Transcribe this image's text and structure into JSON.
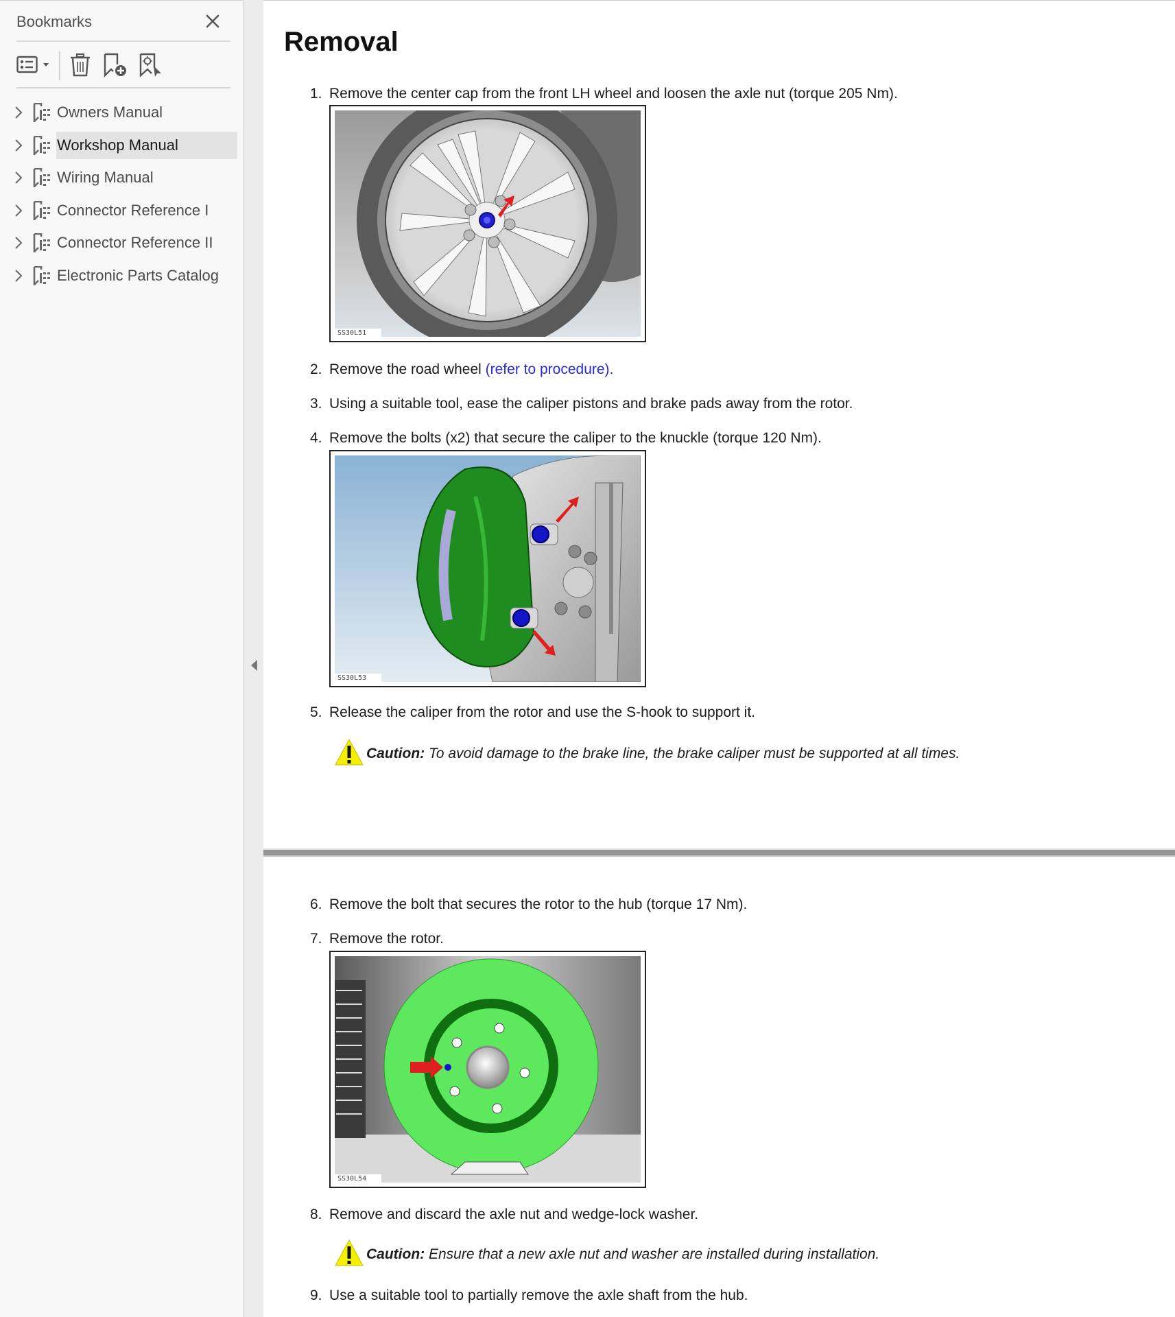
{
  "sidebar": {
    "title": "Bookmarks",
    "toolbar": {
      "options_icon": "list-options-icon",
      "delete_icon": "trash-icon",
      "add_icon": "add-bookmark-icon",
      "find_icon": "find-bookmark-icon"
    },
    "items": [
      {
        "label": "Owners Manual",
        "selected": false
      },
      {
        "label": "Workshop Manual",
        "selected": true
      },
      {
        "label": "Wiring Manual",
        "selected": false
      },
      {
        "label": "Connector Reference I",
        "selected": false
      },
      {
        "label": "Connector Reference II",
        "selected": false
      },
      {
        "label": "Electronic Parts Catalog",
        "selected": false
      }
    ]
  },
  "document": {
    "title": "Removal",
    "steps": [
      {
        "num": "1.",
        "text": "Remove the center cap from the front LH wheel and loosen the axle nut (torque 205 Nm)."
      },
      {
        "num": "2.",
        "text": "Remove the road wheel ",
        "link": "(refer to procedure)",
        "after": "."
      },
      {
        "num": "3.",
        "text": "Using a suitable tool, ease the caliper pistons and brake pads away from the rotor."
      },
      {
        "num": "4.",
        "text": "Remove the bolts (x2) that secure the caliper to the knuckle (torque 120 Nm)."
      },
      {
        "num": "5.",
        "text": "Release the caliper from the rotor and use the S-hook to support it."
      },
      {
        "num": "6.",
        "text": "Remove the bolt that secures the rotor to the hub (torque 17 Nm)."
      },
      {
        "num": "7.",
        "text": "Remove the rotor."
      },
      {
        "num": "8.",
        "text": "Remove and discard the axle nut and wedge-lock washer."
      },
      {
        "num": "9.",
        "text": "Use a suitable tool to partially remove the axle shaft from the hub."
      }
    ],
    "figures": [
      {
        "id": "SS30L51",
        "alt": "Front LH wheel with arrow at center cap / axle nut"
      },
      {
        "id": "SS30L53",
        "alt": "Green brake caliper with two blue mounting bolts indicated by arrows"
      },
      {
        "id": "SS30L54",
        "alt": "Green brake rotor with arrow at rotor retaining bolt"
      }
    ],
    "cautions": [
      {
        "label": "Caution:",
        "text": " To avoid damage to the brake line, the brake caliper must be supported at all times."
      },
      {
        "label": "Caution:",
        "text": " Ensure that a new axle nut and washer are installed during installation."
      }
    ]
  },
  "colors": {
    "link": "#2a2ad0",
    "highlight_green": "#5ee85e",
    "caliper_green": "#1f8c1f",
    "arrow_red": "#e02020",
    "bolt_blue": "#1414c8",
    "warning_yellow": "#f5f000"
  }
}
